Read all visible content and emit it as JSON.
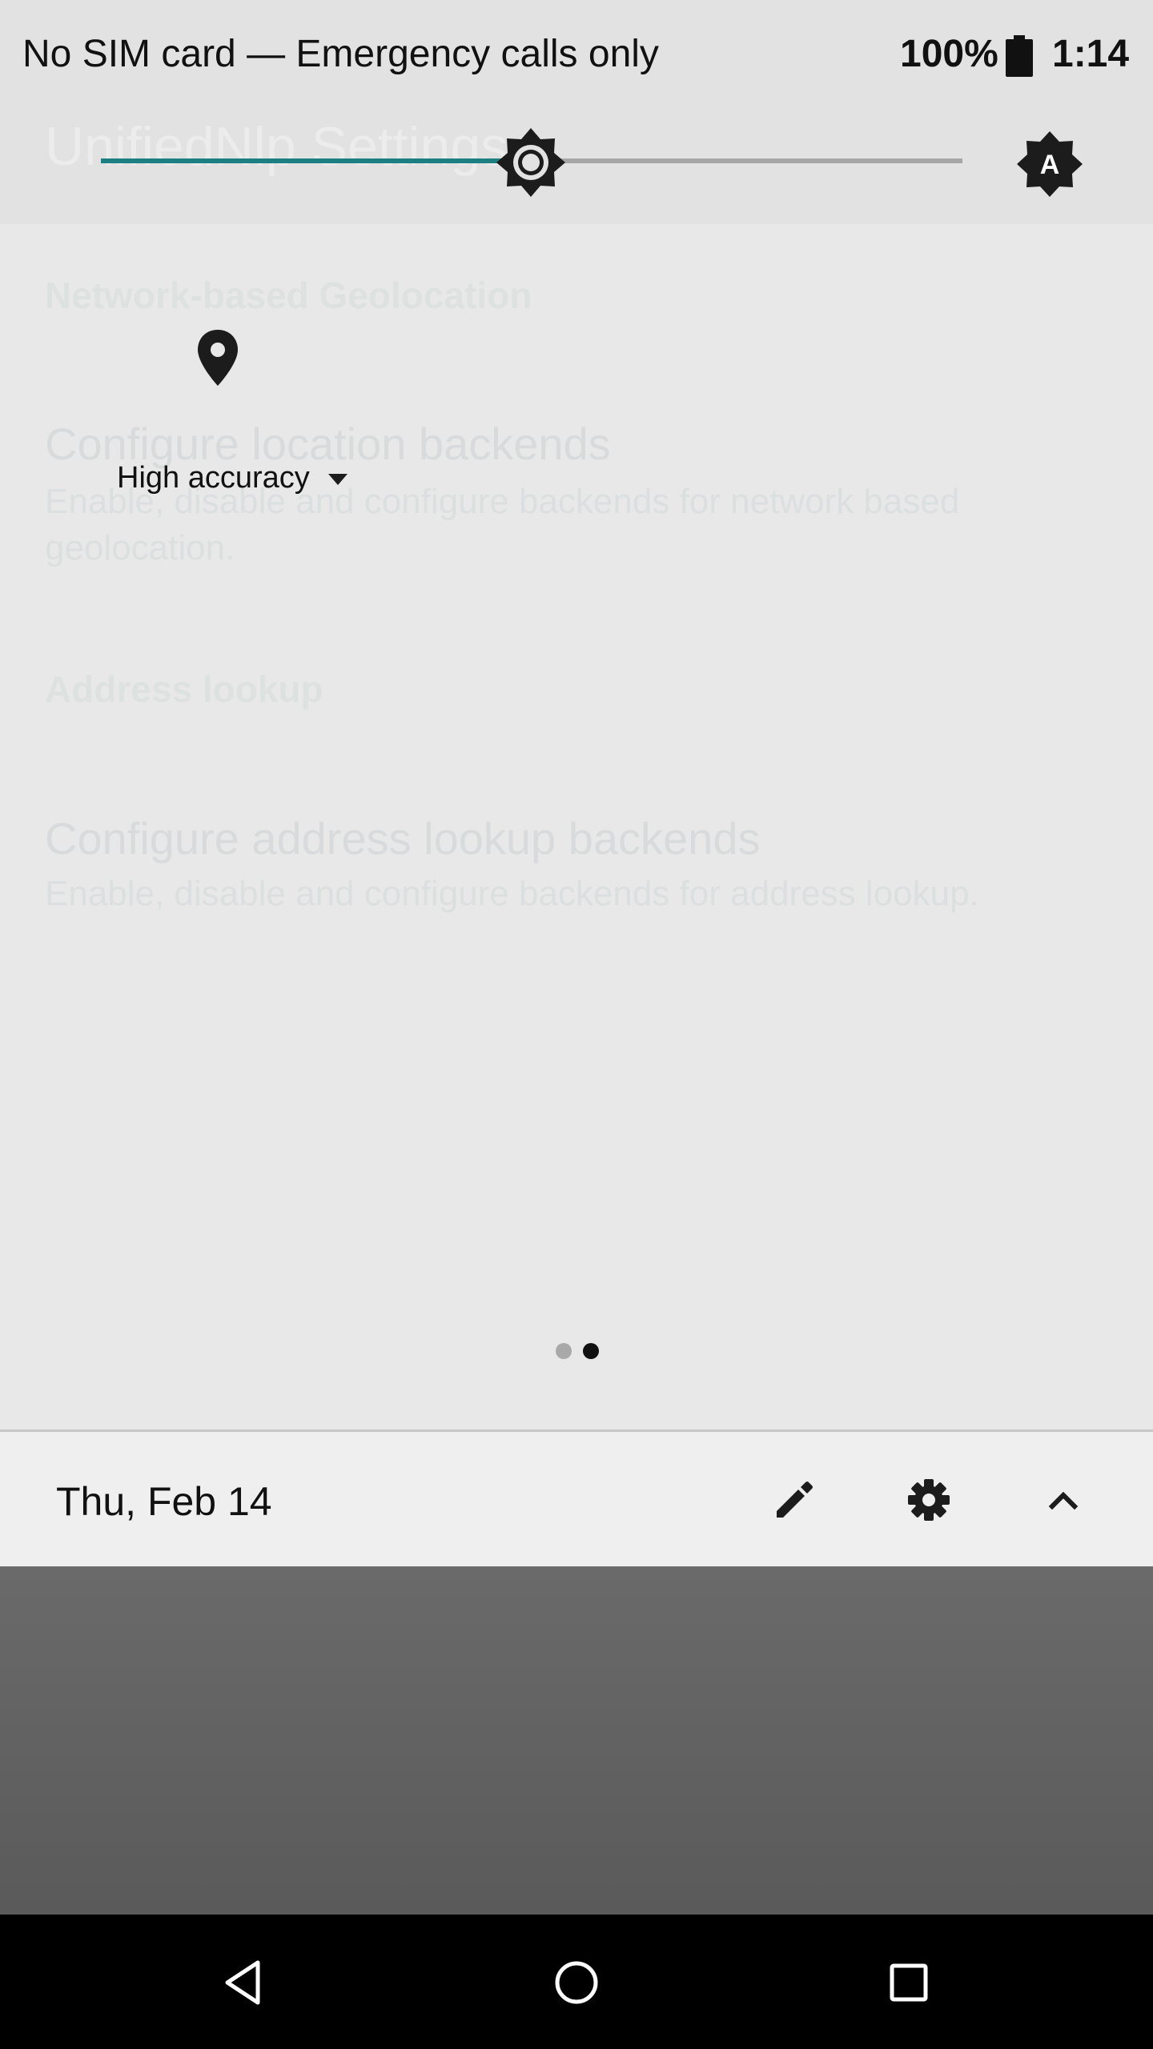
{
  "status_bar": {
    "carrier": "No SIM card — Emergency calls only",
    "battery_percent": "100%",
    "battery_icon": "battery-full-icon",
    "clock": "1:14"
  },
  "background_app": {
    "title": "UnifiedNlp Settings",
    "sections": [
      {
        "header": "Network-based Geolocation",
        "item_title": "Configure location backends",
        "item_summary": "Enable, disable and configure backends for network based geolocation."
      },
      {
        "header": "Address lookup",
        "item_title": "Configure address lookup backends",
        "item_summary": "Enable, disable and configure backends for address lookup."
      }
    ]
  },
  "quick_settings": {
    "brightness": {
      "level": 0.5,
      "accent_color": "#1e7f82",
      "thumb_icon": "brightness-icon",
      "auto_icon": "auto-brightness-icon"
    },
    "tiles": [
      {
        "icon": "location-pin-icon",
        "label": "High accuracy",
        "has_dropdown": true
      }
    ],
    "pages": {
      "count": 2,
      "current": 2
    }
  },
  "footer": {
    "date": "Thu, Feb 14",
    "edit_icon": "pencil-icon",
    "settings_icon": "gear-icon",
    "collapse_icon": "chevron-up-icon"
  },
  "nav_bar": {
    "back_icon": "back-triangle-icon",
    "home_icon": "home-circle-icon",
    "recents_icon": "recents-square-icon"
  }
}
